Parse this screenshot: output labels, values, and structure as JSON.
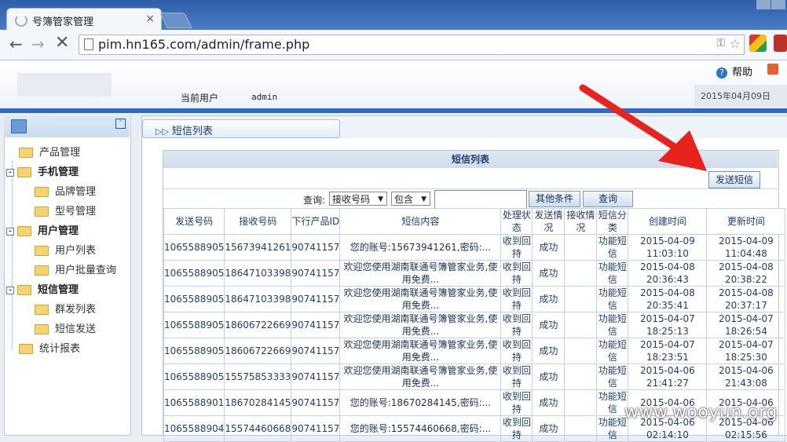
{
  "browser": {
    "tab_title": "号簿管家管理",
    "tab_close": "×",
    "url": "pim.hn165.com/admin/frame.php"
  },
  "header": {
    "help_label": "帮助",
    "current_user_label": "当前用户",
    "current_user": "admin",
    "date": "2015年04月09日"
  },
  "sidebar": {
    "items": [
      {
        "label": "产品管理",
        "level": 0,
        "group": false
      },
      {
        "label": "手机管理",
        "level": 0,
        "group": true
      },
      {
        "label": "品牌管理",
        "level": 1,
        "group": false
      },
      {
        "label": "型号管理",
        "level": 1,
        "group": false
      },
      {
        "label": "用户管理",
        "level": 0,
        "group": true
      },
      {
        "label": "用户列表",
        "level": 1,
        "group": false
      },
      {
        "label": "用户批量查询",
        "level": 1,
        "group": false
      },
      {
        "label": "短信管理",
        "level": 0,
        "group": true
      },
      {
        "label": "群发列表",
        "level": 1,
        "group": false
      },
      {
        "label": "短信发送",
        "level": 1,
        "group": false
      },
      {
        "label": "统计报表",
        "level": 0,
        "group": false
      }
    ]
  },
  "main": {
    "breadcrumb": "短信列表",
    "panel_title": "短信列表",
    "send_button": "发送短信",
    "query_label": "查询:",
    "field_select": "接收号码",
    "match_select": "包含",
    "query_value": "",
    "other_conditions_button": "其他条件",
    "search_button": "查询",
    "columns": [
      "发送号码",
      "接收号码",
      "下行产品ID",
      "短信内容",
      "处理状态",
      "发送情况",
      "接收情况",
      "短信分类",
      "创建时间",
      "更新时间"
    ],
    "rows": [
      [
        "1065588905",
        "15673941261",
        "90741157",
        "您的账号:15673941261,密码:...",
        "收到回持",
        "成功",
        "",
        "功能短信",
        "2015-04-09 11:03:10",
        "2015-04-09 11:04:48"
      ],
      [
        "1065588905",
        "18647103398",
        "90741157",
        "欢迎您使用湖南联通号簿管家业务,使用免费...",
        "收到回持",
        "成功",
        "",
        "功能短信",
        "2015-04-08 20:36:43",
        "2015-04-08 20:38:22"
      ],
      [
        "1065588905",
        "18647103398",
        "90741157",
        "欢迎您使用湖南联通号簿管家业务,使用免费...",
        "收到回持",
        "成功",
        "",
        "功能短信",
        "2015-04-08 20:35:41",
        "2015-04-08 20:37:17"
      ],
      [
        "1065588905",
        "18606722669",
        "90741157",
        "欢迎您使用湖南联通号簿管家业务,使用免费...",
        "收到回持",
        "成功",
        "",
        "功能短信",
        "2015-04-07 18:25:13",
        "2015-04-07 18:26:54"
      ],
      [
        "1065588905",
        "18606722669",
        "90741157",
        "欢迎您使用湖南联通号簿管家业务,使用免费...",
        "收到回持",
        "成功",
        "",
        "功能短信",
        "2015-04-07 18:23:51",
        "2015-04-07 18:25:30"
      ],
      [
        "1065588905",
        "15575853333",
        "90741157",
        "欢迎您使用湖南联通号簿管家业务,使用免费...",
        "收到回持",
        "成功",
        "",
        "功能短信",
        "2015-04-06 21:41:27",
        "2015-04-06 21:43:08"
      ],
      [
        "1065588901",
        "18670284145",
        "90741157",
        "您的账号:18670284145,密码:...",
        "收到回持",
        "成功",
        "",
        "功能短信",
        "2015-04-06",
        "2015-04-06"
      ],
      [
        "1065588904",
        "15574460668",
        "90741157",
        "您的账号:15574460668,密码:...",
        "收到回持",
        "成功",
        "",
        "功能短信",
        "2015-04-06 02:14:10",
        "2015-04-06 02:15:56"
      ]
    ]
  },
  "annotation": {
    "arrow_color": "#e8231e",
    "watermark": "www.wooyun.org"
  }
}
